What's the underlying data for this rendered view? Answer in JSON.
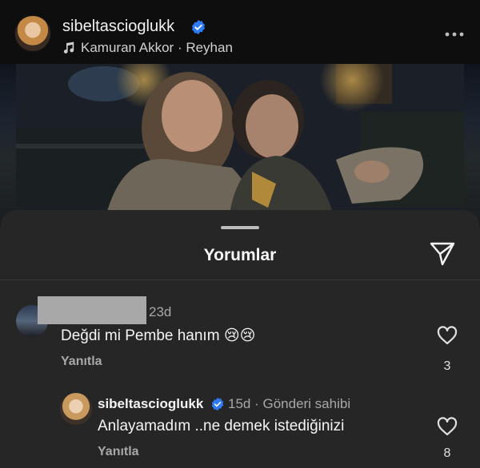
{
  "post": {
    "username": "sibeltascioglukk",
    "audio": "Kamuran Akkor · Reyhan"
  },
  "sheet": {
    "title": "Yorumlar"
  },
  "comments": [
    {
      "time": "23d",
      "text": "Değdi mi Pembe hanım 😢😢",
      "reply_label": "Yanıtla",
      "likes": "3"
    },
    {
      "username": "sibeltascioglukk",
      "time": "15d",
      "author_tag": "Gönderi sahibi",
      "text": "Anlayamadım ..ne demek istediğinizi",
      "reply_label": "Yanıtla",
      "likes": "8"
    }
  ],
  "colors": {
    "background": "#262626",
    "verified": "#2f7bf6",
    "secondary_text": "#a8a8a8"
  }
}
